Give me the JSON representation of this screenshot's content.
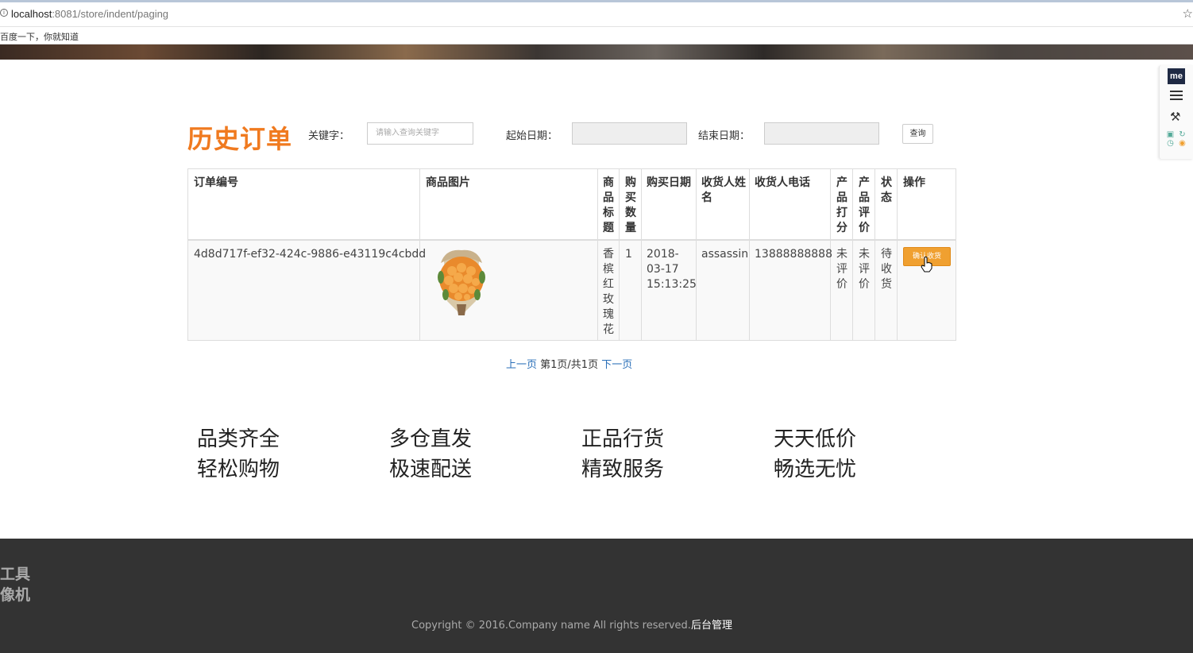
{
  "browser": {
    "url_host": "localhost",
    "url_path": ":8081/store/indent/paging",
    "bookmark": "百度一下，你就知道"
  },
  "header": {
    "title": "历史订单",
    "keyword_label": "关键字：",
    "keyword_placeholder": "请输入查询关键字",
    "start_label": "起始日期：",
    "end_label": "结束日期：",
    "query_button": "查询"
  },
  "table": {
    "headers": {
      "order_no": "订单编号",
      "image": "商品图片",
      "title": "商品标题",
      "qty": "购买数量",
      "date": "购买日期",
      "name": "收货人姓名",
      "phone": "收货人电话",
      "score": "产品打分",
      "review": "产品评价",
      "status": "状态",
      "action": "操作"
    },
    "rows": [
      {
        "order_no": "4d8d717f-ef32-424c-9886-e43119c4cbdd",
        "title": "香槟红玫瑰花",
        "qty": "1",
        "date": "2018-03-17 15:13:25",
        "name": "assassin",
        "phone": "13888888888",
        "score": "未评价",
        "review": "未评价",
        "status": "待收货",
        "action": "确认收货"
      }
    ]
  },
  "pager": {
    "prev": "上一页",
    "info": "第1页/共1页",
    "next": "下一页"
  },
  "features": [
    {
      "line1": "品类齐全",
      "line2": "轻松购物"
    },
    {
      "line1": "多仓直发",
      "line2": "极速配送"
    },
    {
      "line1": "正品行货",
      "line2": "精致服务"
    },
    {
      "line1": "天天低价",
      "line2": "畅选无忧"
    }
  ],
  "footer": {
    "left_line1": "工具",
    "left_line2": "像机",
    "copyright": "Copyright © 2016.Company name All rights reserved.",
    "admin_link": "后台管理"
  },
  "widget": {
    "me_label": "me"
  },
  "colors": {
    "accent": "#f07a1f",
    "button": "#f0a030",
    "link": "#2a6fb8",
    "footer": "#333333"
  }
}
